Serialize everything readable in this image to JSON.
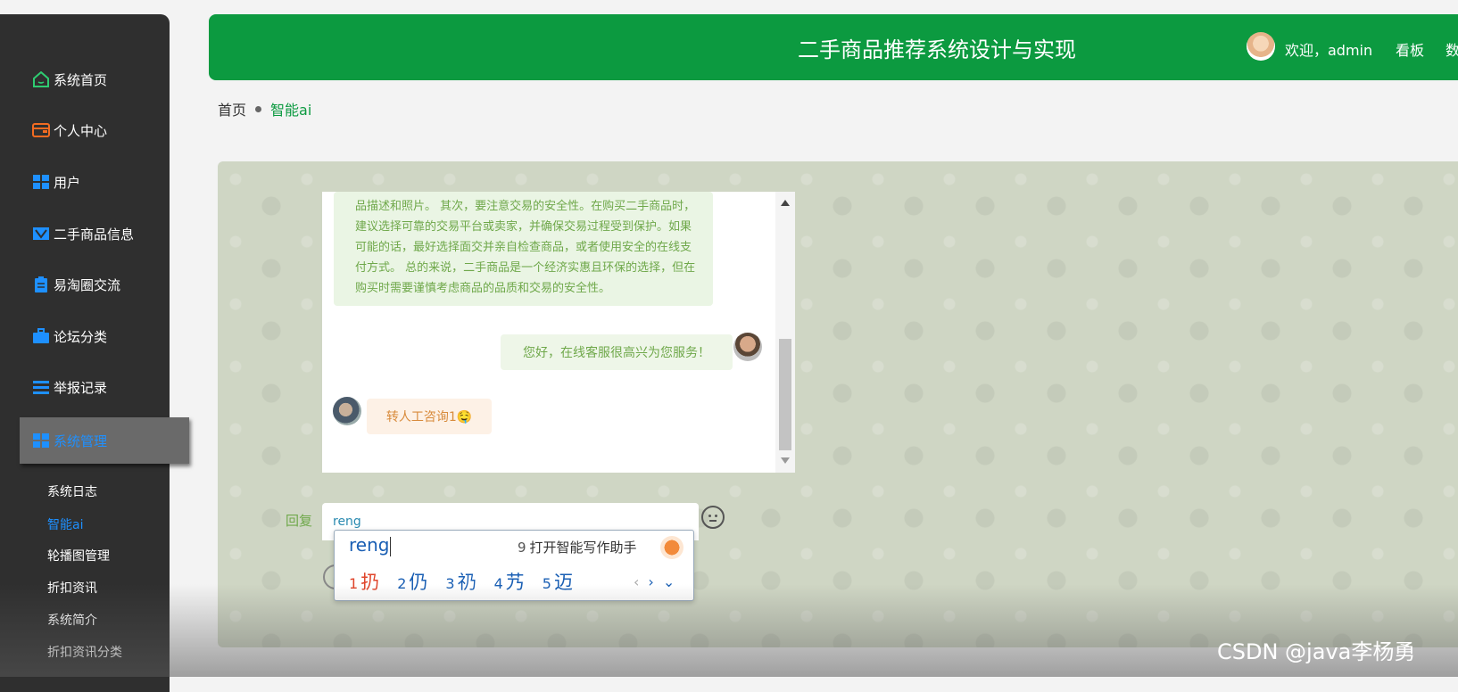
{
  "sidebar": {
    "items": [
      {
        "label": "系统首页",
        "icon": "home-icon",
        "color": "#2ecc71"
      },
      {
        "label": "个人中心",
        "icon": "wallet-icon",
        "color": "#f26b21"
      },
      {
        "label": "用户",
        "icon": "grid-icon",
        "color": "#1e90ff"
      },
      {
        "label": "二手商品信息",
        "icon": "layout-icon",
        "color": "#1e90ff"
      },
      {
        "label": "易淘圈交流",
        "icon": "clipboard-icon",
        "color": "#1e90ff"
      },
      {
        "label": "论坛分类",
        "icon": "briefcase-icon",
        "color": "#1e90ff"
      },
      {
        "label": "举报记录",
        "icon": "list-icon",
        "color": "#1e90ff"
      },
      {
        "label": "系统管理",
        "icon": "grid-icon",
        "color": "#1e90ff"
      }
    ],
    "subitems": [
      "系统日志",
      "智能ai",
      "轮播图管理",
      "折扣资讯",
      "系统简介",
      "折扣资讯分类"
    ],
    "active_sub": "智能ai"
  },
  "header": {
    "title": "二手商品推荐系统设计与实现",
    "welcome": "欢迎，admin",
    "link1": "看板",
    "link2": "数"
  },
  "breadcrumb": {
    "home": "首页",
    "current": "智能ai"
  },
  "chat": {
    "ai_message": "品描述和照片。 其次，要注意交易的安全性。在购买二手商品时，建议选择可靠的交易平台或卖家，并确保交易过程受到保护。如果可能的话，最好选择面交并亲自检查商品，或者使用安全的在线支付方式。 总的来说，二手商品是一个经济实惠且环保的选择，但在购买时需要谨慎考虑商品的品质和交易的安全性。",
    "cs_message": "您好，在线客服很高兴为您服务！",
    "user_message": "转人工咨询1🤤"
  },
  "reply": {
    "label": "回复",
    "value": "reng"
  },
  "ime": {
    "input": "reng",
    "tip_num": "9",
    "tip": "打开智能写作助手",
    "candidates": [
      {
        "n": "1",
        "ch": "扔"
      },
      {
        "n": "2",
        "ch": "仍"
      },
      {
        "n": "3",
        "ch": "礽"
      },
      {
        "n": "4",
        "ch": "艿"
      },
      {
        "n": "5",
        "ch": "迈"
      }
    ]
  },
  "watermark": "CSDN @java李杨勇",
  "colors": {
    "header_green": "#0c9a40",
    "sidebar_bg": "#2f2f2f",
    "active_blue": "#1e90ff"
  }
}
